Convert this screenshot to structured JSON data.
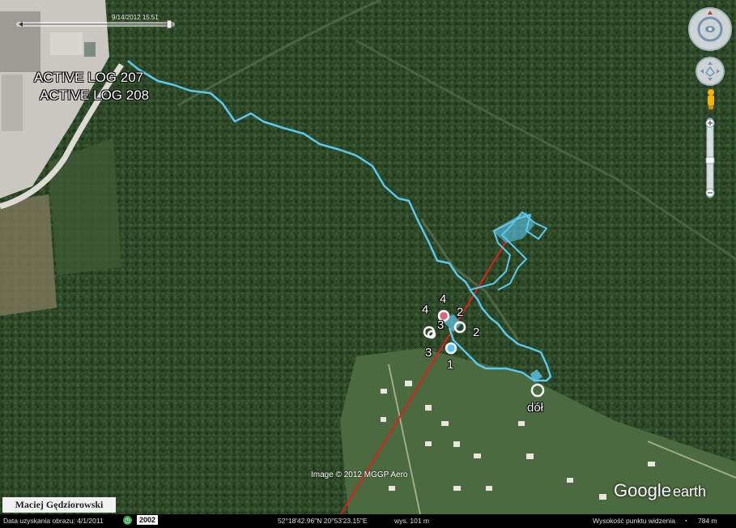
{
  "map": {
    "track_labels": [
      "ACTIVE LOG 207",
      "ACTIVE LOG 208"
    ],
    "waypoints": [
      {
        "label": "4"
      },
      {
        "label": "3"
      },
      {
        "label": "3"
      },
      {
        "label": "4"
      },
      {
        "label": "2"
      },
      {
        "label": "2"
      },
      {
        "label": "1"
      },
      {
        "label": "dół"
      }
    ],
    "colors": {
      "track": "#5bc8f0",
      "line": "#e0201a",
      "forest": "#2e4a28",
      "field": "#7a7458"
    }
  },
  "time_slider": {
    "date": "9/14/2012  15:51"
  },
  "image_credit": "Image © 2012 MGGP Aero",
  "author_badge": "Maciej Gędziorowski",
  "logo": {
    "google": "Google",
    "earth": "earth"
  },
  "status_bar": {
    "imagery_date": "Data uzyskania obrazu: 4/1/2011",
    "history_year": "2002",
    "coordinates": "52°18'42.96\"N  20°53'23.15\"E",
    "elevation": "wys.  101 m",
    "eye_alt": "Wysokość punktu widzenia",
    "eye_alt_value": "784 m"
  },
  "nav_controls": {
    "icons": [
      "look-joystick-icon",
      "move-joystick-icon",
      "pegman-icon",
      "zoom-in-icon",
      "zoom-out-icon"
    ]
  }
}
